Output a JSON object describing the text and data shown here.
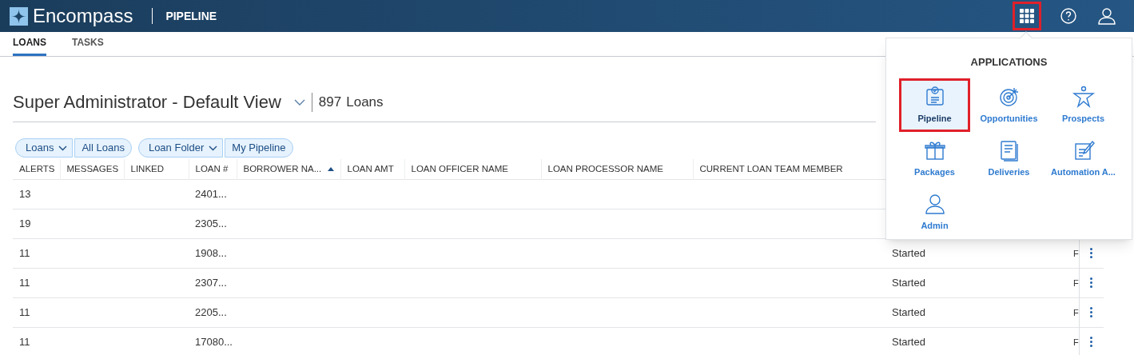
{
  "header": {
    "brand": "Encompass",
    "section": "PIPELINE",
    "apps_open": true
  },
  "tabs": [
    {
      "label": "LOANS",
      "selected": true
    },
    {
      "label": "TASKS",
      "selected": false
    }
  ],
  "view": {
    "title": "Super Administrator - Default View",
    "count": "897",
    "count_label": "Loans"
  },
  "filters": [
    {
      "label": "Loans",
      "value": "All Loans"
    },
    {
      "label": "Loan Folder",
      "value": "My Pipeline"
    }
  ],
  "table": {
    "columns": [
      {
        "label": "ALERTS",
        "sorted": false
      },
      {
        "label": "MESSAGES",
        "sorted": false
      },
      {
        "label": "LINKED",
        "sorted": false
      },
      {
        "label": "LOAN #",
        "sorted": false
      },
      {
        "label": "BORROWER NA...",
        "sorted": true
      },
      {
        "label": "LOAN AMT",
        "sorted": false
      },
      {
        "label": "LOAN OFFICER NAME",
        "sorted": false
      },
      {
        "label": "LOAN PROCESSOR NAME",
        "sorted": false
      },
      {
        "label": "CURRENT LOAN TEAM MEMBER",
        "sorted": false
      }
    ],
    "rows": [
      {
        "alerts": "13",
        "loan": "2401..."
      },
      {
        "alerts": "19",
        "loan": "2305..."
      },
      {
        "alerts": "11",
        "loan": "1908...",
        "column_10": "Started",
        "column_11": "F"
      },
      {
        "alerts": "11",
        "loan": "2307...",
        "column_10": "Started",
        "column_11": "F"
      },
      {
        "alerts": "11",
        "loan": "2205...",
        "column_10": "Started",
        "column_11": "F"
      },
      {
        "alerts": "11",
        "loan": "17080...",
        "column_10": "Started",
        "column_11": "F"
      }
    ]
  },
  "applications": {
    "title": "APPLICATIONS",
    "items": [
      {
        "label": "Pipeline",
        "kind": "pipeline",
        "selected": true
      },
      {
        "label": "Opportunities",
        "kind": "target",
        "selected": false
      },
      {
        "label": "Prospects",
        "kind": "star",
        "selected": false
      },
      {
        "label": "Packages",
        "kind": "gift",
        "selected": false
      },
      {
        "label": "Deliveries",
        "kind": "document",
        "selected": false
      },
      {
        "label": "Automation A...",
        "kind": "edit",
        "selected": false
      },
      {
        "label": "Admin",
        "kind": "person",
        "selected": false
      }
    ]
  }
}
